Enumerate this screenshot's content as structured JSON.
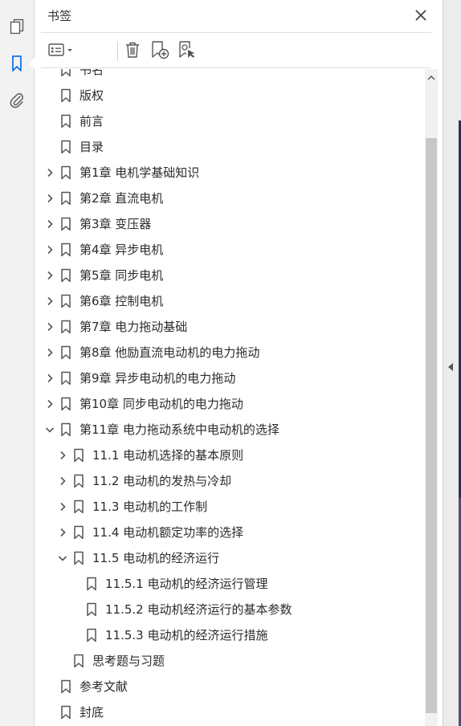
{
  "sidebar": {
    "title": "书签",
    "nav_icons": [
      "pages-icon",
      "bookmark-icon",
      "attachment-icon"
    ]
  },
  "toolbar": {
    "icons": [
      "options-menu-icon",
      "delete-bookmark-icon",
      "new-bookmark-icon",
      "bookmark-search-icon"
    ]
  },
  "bookmarks": [
    {
      "label": "书名",
      "level": 0,
      "state": "none"
    },
    {
      "label": "版权",
      "level": 0,
      "state": "none"
    },
    {
      "label": "前言",
      "level": 0,
      "state": "none"
    },
    {
      "label": "目录",
      "level": 0,
      "state": "none"
    },
    {
      "label": "第1章  电机学基础知识",
      "level": 0,
      "state": "collapsed"
    },
    {
      "label": "第2章  直流电机",
      "level": 0,
      "state": "collapsed"
    },
    {
      "label": "第3章  变压器",
      "level": 0,
      "state": "collapsed"
    },
    {
      "label": "第4章  异步电机",
      "level": 0,
      "state": "collapsed"
    },
    {
      "label": "第5章  同步电机",
      "level": 0,
      "state": "collapsed"
    },
    {
      "label": "第6章  控制电机",
      "level": 0,
      "state": "collapsed"
    },
    {
      "label": "第7章  电力拖动基础",
      "level": 0,
      "state": "collapsed"
    },
    {
      "label": "第8章  他励直流电动机的电力拖动",
      "level": 0,
      "state": "collapsed"
    },
    {
      "label": "第9章  异步电动机的电力拖动",
      "level": 0,
      "state": "collapsed"
    },
    {
      "label": "第10章  同步电动机的电力拖动",
      "level": 0,
      "state": "collapsed"
    },
    {
      "label": "第11章  电力拖动系统中电动机的选择",
      "level": 0,
      "state": "expanded"
    },
    {
      "label": "11.1  电动机选择的基本原则",
      "level": 1,
      "state": "collapsed"
    },
    {
      "label": "11.2  电动机的发热与冷却",
      "level": 1,
      "state": "collapsed"
    },
    {
      "label": "11.3  电动机的工作制",
      "level": 1,
      "state": "collapsed"
    },
    {
      "label": "11.4  电动机额定功率的选择",
      "level": 1,
      "state": "collapsed"
    },
    {
      "label": "11.5  电动机的经济运行",
      "level": 1,
      "state": "expanded"
    },
    {
      "label": "11.5.1  电动机的经济运行管理",
      "level": 2,
      "state": "none"
    },
    {
      "label": "11.5.2  电动机经济运行的基本参数",
      "level": 2,
      "state": "none"
    },
    {
      "label": "11.5.3  电动机的经济运行措施",
      "level": 2,
      "state": "none"
    },
    {
      "label": "思考题与习题",
      "level": 1,
      "state": "none"
    },
    {
      "label": "参考文献",
      "level": 0,
      "state": "none"
    },
    {
      "label": "封底",
      "level": 0,
      "state": "none"
    }
  ],
  "colors": {
    "accent": "#1473e6",
    "icon": "#555555",
    "text": "#2b2b2b"
  }
}
